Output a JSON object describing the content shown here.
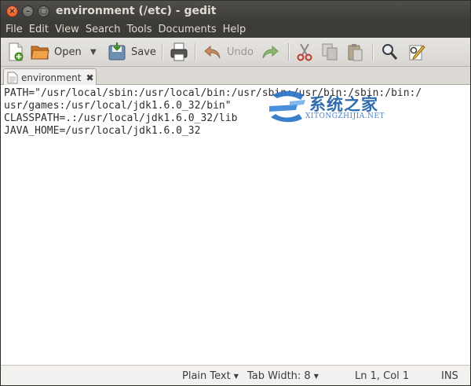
{
  "window": {
    "title": "environment (/etc) - gedit",
    "close_glyph": "×",
    "min_glyph": "–",
    "max_glyph": "□"
  },
  "menu": [
    "File",
    "Edit",
    "View",
    "Search",
    "Tools",
    "Documents",
    "Help"
  ],
  "toolbar": {
    "open_label": "Open",
    "save_label": "Save",
    "undo_label": "Undo",
    "dropdown_glyph": "▼"
  },
  "tab": {
    "label": "environment",
    "close_glyph": "✖"
  },
  "document": {
    "lines": [
      "PATH=\"/usr/local/sbin:/usr/local/bin:/usr/sbin:/usr/bin:/sbin:/bin:/",
      "usr/games:/usr/local/jdk1.6.0_32/bin\"",
      "CLASSPATH=.:/usr/local/jdk1.6.0_32/lib",
      "JAVA_HOME=/usr/local/jdk1.6.0_32"
    ]
  },
  "watermark": {
    "text": "系统之家",
    "sub": "XITONGZHIJIA.NET"
  },
  "status": {
    "language": "Plain Text",
    "tab_width": "Tab Width:  8",
    "position": "Ln 1, Col 1",
    "mode": "INS",
    "dropdown_glyph": "▼"
  },
  "colors": {
    "titlebar": "#3c3b37",
    "close_button": "#e0541f",
    "editor_bg": "#ffffff",
    "watermark": "#1f5fa8"
  }
}
